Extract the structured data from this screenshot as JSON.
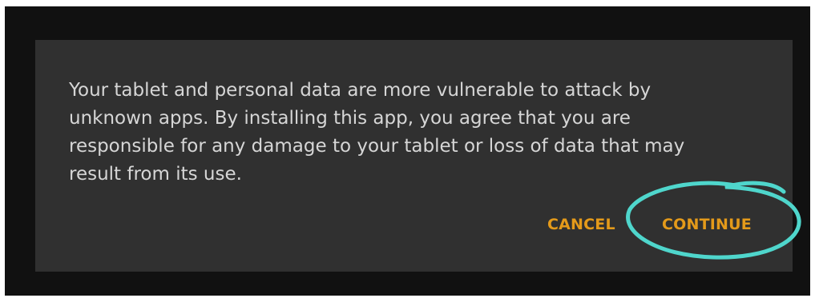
{
  "dialog": {
    "message": "Your tablet and personal data are more vulnerable to attack by unknown apps. By installing this app, you agree that you are responsible for any damage to your tablet or loss of data that may result from its use.",
    "cancel_label": "CANCEL",
    "continue_label": "CONTINUE"
  },
  "colors": {
    "screen_background": "#111111",
    "dialog_background": "#303030",
    "message_text": "#d6d6d6",
    "button_accent": "#e49a1a",
    "highlight_stroke": "#4fd6cc"
  }
}
